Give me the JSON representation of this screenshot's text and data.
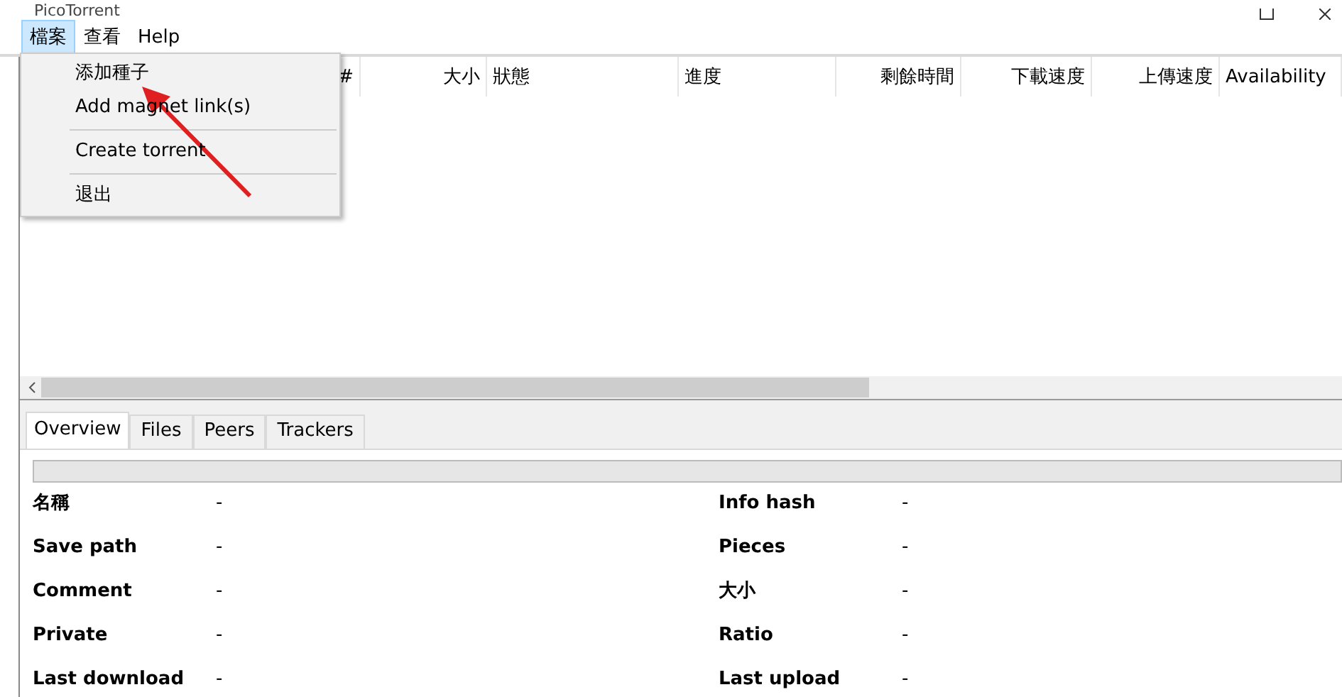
{
  "window": {
    "title": "PicoTorrent"
  },
  "menubar": [
    {
      "label": "檔案",
      "selected": true
    },
    {
      "label": "查看",
      "selected": false
    },
    {
      "label": "Help",
      "selected": false
    }
  ],
  "menu": [
    {
      "kind": "item",
      "label": "添加種子"
    },
    {
      "kind": "item",
      "label": "Add magnet link(s)"
    },
    {
      "kind": "separator"
    },
    {
      "kind": "item",
      "label": "Create torrent"
    },
    {
      "kind": "separator"
    },
    {
      "kind": "item",
      "label": "退出"
    }
  ],
  "table": {
    "columns": [
      {
        "label": "#"
      },
      {
        "label": "大小"
      },
      {
        "label": "狀態"
      },
      {
        "label": "進度"
      },
      {
        "label": "剩餘時間"
      },
      {
        "label": "下載速度"
      },
      {
        "label": "上傳速度"
      },
      {
        "label": "Availability"
      }
    ]
  },
  "tabs": [
    {
      "label": "Overview",
      "selected": true
    },
    {
      "label": "Files",
      "selected": false
    },
    {
      "label": "Peers",
      "selected": false
    },
    {
      "label": "Trackers",
      "selected": false
    }
  ],
  "progress": {
    "level": 0
  },
  "details": {
    "left": [
      {
        "label": "名稱",
        "value": "-"
      },
      {
        "label": "Save path",
        "value": "-"
      },
      {
        "label": "Comment",
        "value": "-"
      },
      {
        "label": "Private",
        "value": "-"
      },
      {
        "label": "Last download",
        "value": "-"
      }
    ],
    "right": [
      {
        "label": "Info hash",
        "value": "-"
      },
      {
        "label": "Pieces",
        "value": "-"
      },
      {
        "label": "大小",
        "value": "-"
      },
      {
        "label": "Ratio",
        "value": "-"
      },
      {
        "label": "Last upload",
        "value": "-"
      }
    ]
  }
}
